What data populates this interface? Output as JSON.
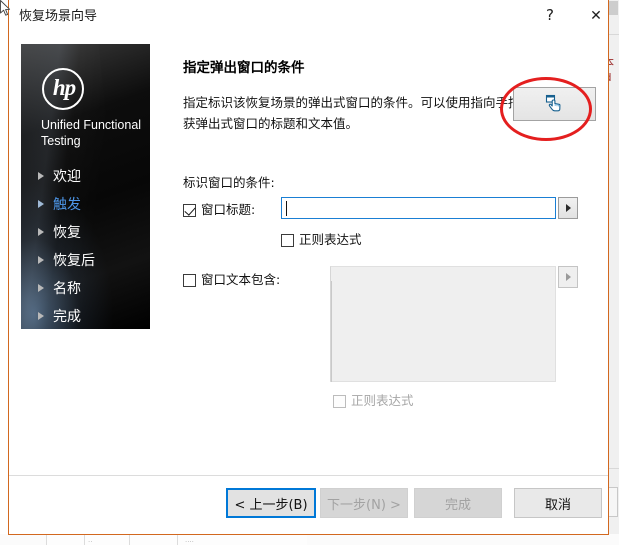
{
  "window": {
    "title": "恢复场景向导",
    "help_label": "?",
    "close_label": "✕",
    "border_color": "#d2681f"
  },
  "sidebar": {
    "brand": "Unified Functional Testing",
    "logo_text": "hp",
    "active_color": "#4d96e8",
    "items": [
      {
        "label": "欢迎",
        "active": false
      },
      {
        "label": "触发",
        "active": true
      },
      {
        "label": "恢复",
        "active": false
      },
      {
        "label": "恢复后",
        "active": false
      },
      {
        "label": "名称",
        "active": false
      },
      {
        "label": "完成",
        "active": false
      }
    ]
  },
  "main": {
    "page_title": "指定弹出窗口的条件",
    "description": "指定标识该恢复场景的弹出式窗口的条件。可以使用指向手捕获弹出式窗口的标题和文本值。",
    "pick_button_icon": "pointing-hand-icon",
    "annotation_color": "#e41f1f",
    "conditions_label": "标识窗口的条件:",
    "window_title": {
      "checkbox_label": "窗口标题:",
      "checked": true,
      "value": "",
      "placeholder": "",
      "regex_label": "正则表达式",
      "regex_checked": false,
      "regex_disabled": false
    },
    "window_text": {
      "checkbox_label": "窗口文本包含:",
      "checked": false,
      "value": "",
      "placeholder": "",
      "regex_label": "正则表达式",
      "regex_checked": false,
      "regex_disabled": true
    }
  },
  "footer": {
    "back": "< 上一步(B)",
    "next": "下一步(N) >",
    "finish": "完成",
    "cancel": "取消",
    "focus_color": "#0078d7"
  },
  "background": {
    "text_line1": "本",
    "text_line2": "'d"
  }
}
